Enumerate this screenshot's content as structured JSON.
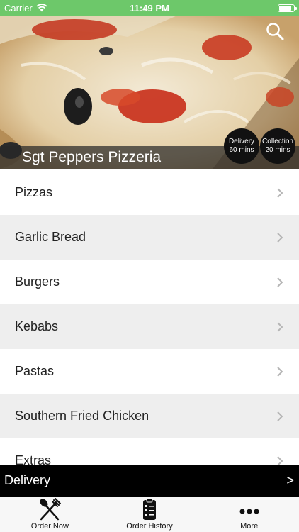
{
  "status_bar": {
    "carrier": "Carrier",
    "time": "11:49 PM",
    "battery_level": 0.9
  },
  "header": {
    "restaurant_name": "Sgt Peppers Pizzeria",
    "search_icon": "search-icon",
    "delivery_badge": {
      "label": "Delivery",
      "time": "60 mins"
    },
    "collection_badge": {
      "label": "Collection",
      "time": "20 mins"
    }
  },
  "categories": [
    {
      "label": "Pizzas"
    },
    {
      "label": "Garlic Bread"
    },
    {
      "label": "Burgers"
    },
    {
      "label": "Kebabs"
    },
    {
      "label": "Pastas"
    },
    {
      "label": "Southern Fried Chicken"
    },
    {
      "label": "Extras"
    }
  ],
  "delivery_bar": {
    "label": "Delivery",
    "arrow": ">"
  },
  "tab_bar": {
    "tabs": [
      {
        "label": "Order Now",
        "icon": "fork-knife-icon"
      },
      {
        "label": "Order History",
        "icon": "clipboard-icon"
      },
      {
        "label": "More",
        "icon": "more-dots-icon"
      }
    ]
  },
  "colors": {
    "status_bar": "#6dc86a",
    "delivery_bar": "#000000",
    "row_alt": "#eeeeee"
  }
}
